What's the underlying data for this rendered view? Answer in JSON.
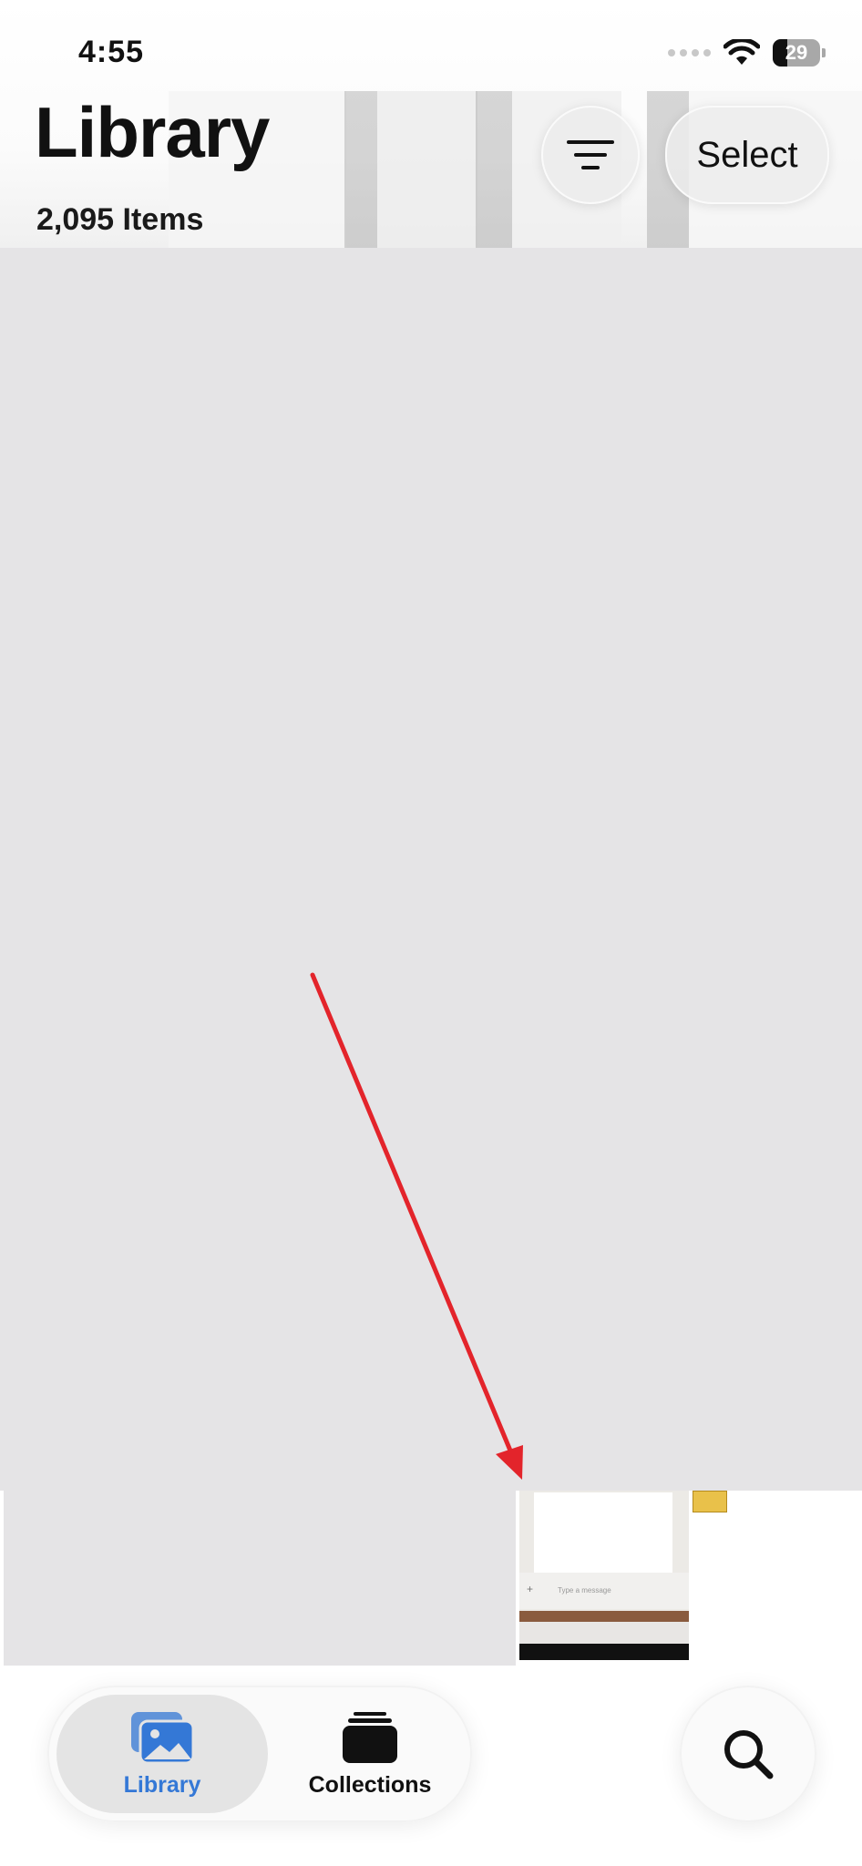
{
  "status_bar": {
    "time": "4:55",
    "battery_level": "29",
    "wifi_icon": "wifi-icon"
  },
  "header": {
    "title": "Library",
    "item_count": "2,095 Items",
    "sort_icon": "sort-lines-icon",
    "select_label": "Select"
  },
  "thumbnail": {
    "message_placeholder": "Type a message"
  },
  "tab_bar": {
    "tabs": [
      {
        "label": "Library",
        "icon": "photo-library-icon",
        "selected": true
      },
      {
        "label": "Collections",
        "icon": "collections-stack-icon",
        "selected": false
      }
    ],
    "search_icon": "search-icon"
  },
  "annotation": {
    "arrow_color": "#e3242b"
  },
  "colors": {
    "accent": "#3478d6",
    "placeholder_gray": "#e5e4e6"
  }
}
